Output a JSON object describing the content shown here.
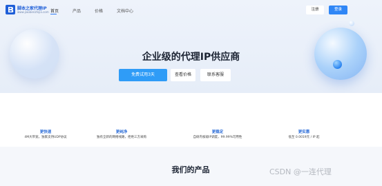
{
  "header": {
    "brand_name": "脚本之家代理IP",
    "brand_url": "www.jiaobenzhijia.com",
    "nav": [
      "首页",
      "产品",
      "价格",
      "文档中心"
    ],
    "register_label": "注册",
    "login_label": "登录"
  },
  "hero": {
    "title": "企业级的代理IP供应商",
    "cta_primary": "免费试用3天",
    "cta_price": "查看价格",
    "cta_contact": "联系客服"
  },
  "features": [
    {
      "title": "更快速",
      "desc": "4M大带宽，独家支持UDP协议"
    },
    {
      "title": "更纯净",
      "desc": "独有全新的网络线路，拒绝三方采购"
    },
    {
      "title": "更稳定",
      "desc": "自研内核级IP调度，99.99%可用性"
    },
    {
      "title": "更实惠",
      "desc": "低至 0.0019元 / IP 起"
    }
  ],
  "products": {
    "title": "我们的产品"
  },
  "watermark": "CSDN @一连代理",
  "colors": {
    "accent": "#2f86f6",
    "feature_title": "#2f6fd8",
    "hero_bg": "#eef3fb"
  }
}
